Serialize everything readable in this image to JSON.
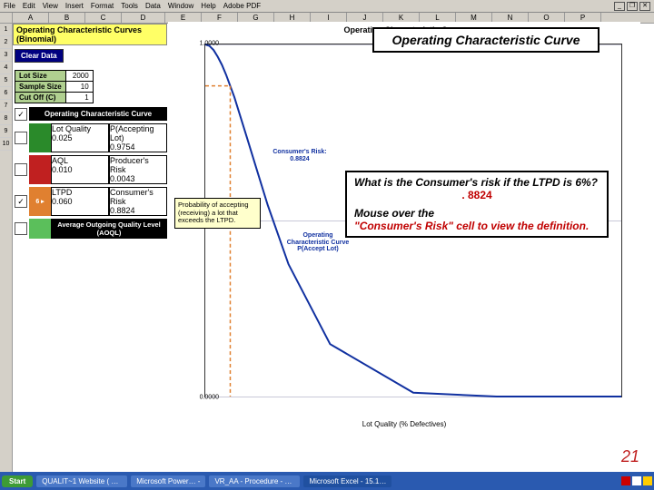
{
  "menu": {
    "items": [
      "File",
      "Edit",
      "View",
      "Insert",
      "Format",
      "Tools",
      "Data",
      "Window",
      "Help",
      "Adobe PDF"
    ]
  },
  "columns": [
    "A",
    "B",
    "C",
    "D",
    "E",
    "F",
    "G",
    "H",
    "I",
    "J",
    "K",
    "L",
    "M",
    "N",
    "O",
    "P"
  ],
  "title_cell": "Operating Characteristic Curves (Binomial)",
  "clear_btn": "Clear Data",
  "params": {
    "rows": [
      {
        "label": "Lot Size",
        "value": "2000"
      },
      {
        "label": "Sample Size",
        "value": "10"
      },
      {
        "label": "Cut Off (C)",
        "value": "1"
      }
    ]
  },
  "blocks": {
    "occ": {
      "chk": "✓",
      "title": "Operating Characteristic Curve"
    },
    "lotq": {
      "tag": "",
      "left_hdr": "Lot Quality",
      "left_val": "0.025",
      "right_hdr": "P(Accepting Lot)",
      "right_val": "0.9754"
    },
    "aql": {
      "tag": "",
      "left_hdr": "AQL",
      "left_val": "0.010",
      "right_hdr": "Producer's Risk",
      "right_val": "0.0043"
    },
    "ltpd": {
      "tag": "✓",
      "taglabel": "6 ▸",
      "left_hdr": "LTPD",
      "left_val": "0.060",
      "right_hdr": "Consumer's Risk",
      "right_val": "0.8824"
    },
    "aoql": {
      "tag": "",
      "title": "Average Outgoing Quality Level (AOQL)"
    }
  },
  "tooltip": "Probability of accepting (receiving) a lot that exceeds the LTPD.",
  "chart": {
    "title": "Operating Characteristic Curve",
    "xlabel": "Lot Quality (% Defectives)",
    "anno1": {
      "l1": "Consumer's Risk:",
      "l2": "0.8824"
    },
    "anno2": {
      "l1": "Operating",
      "l2": "Characteristic Curve",
      "l3": "P(Accept Lot)"
    }
  },
  "chart_data": {
    "type": "line",
    "title": "Operating Characteristic Curve",
    "xlabel": "Lot Quality (% Defectives)",
    "ylabel": "P(Accept Lot)",
    "ylim": [
      0,
      1
    ],
    "yticks": [
      0.0,
      0.1,
      0.2,
      0.3,
      0.4,
      0.5,
      0.6,
      0.7,
      0.8,
      0.9,
      1.0
    ],
    "x": [
      0.0,
      0.01,
      0.02,
      0.03,
      0.04,
      0.05,
      0.06,
      0.07,
      0.08,
      0.1,
      0.12,
      0.15,
      0.2,
      0.3,
      0.5,
      0.7,
      1.0
    ],
    "values": [
      1.0,
      0.996,
      0.984,
      0.965,
      0.942,
      0.914,
      0.882,
      0.85,
      0.812,
      0.736,
      0.659,
      0.544,
      0.376,
      0.149,
      0.011,
      0.0001,
      0.0
    ],
    "markers": {
      "consumers_risk_x": 0.06,
      "consumers_risk_y": 0.8824
    }
  },
  "callouts": {
    "title": "Operating Characteristic Curve",
    "q1": "What is the Consumer's risk if the LTPD is 6%?",
    "ans": ". 8824",
    "q2a": "Mouse over the",
    "q2b": "\"Consumer's Risk\" cell to view the definition."
  },
  "taskbar": {
    "start": "Start",
    "items": [
      "QUALIT~1 Website ( all…",
      "Microsoft Power… -",
      "VR_AA - Procedure - Visual…",
      "Microsoft Excel - 15.1…"
    ]
  },
  "slide_number": "21"
}
